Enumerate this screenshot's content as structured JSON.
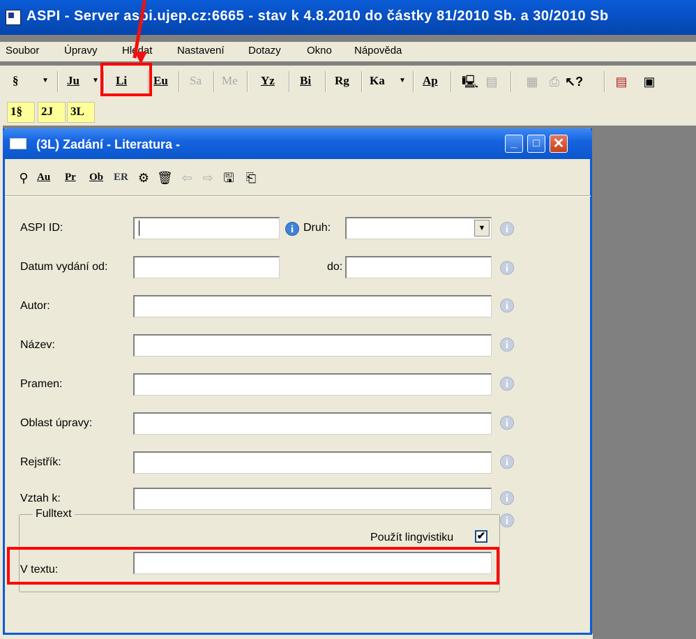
{
  "app": {
    "title": "ASPI - Server aspi.ujep.cz:6665 - stav k 4.8.2010 do částky 81/2010 Sb. a 30/2010 Sb"
  },
  "menu": [
    "Soubor",
    "Úpravy",
    "Hledat",
    "Nastavení",
    "Dotazy",
    "Okno",
    "Nápověda"
  ],
  "toolbar": {
    "buttons": [
      "§",
      "Ju",
      "Li",
      "Eu",
      "Sa",
      "Me",
      "Yz",
      "Bi",
      "Rg",
      "Ka",
      "Ap"
    ]
  },
  "tabs": [
    "1§",
    "2J",
    "3L"
  ],
  "window": {
    "title": "(3L)  Zadání - Literatura -",
    "minimize": "_",
    "maximize": "□",
    "close": "✕"
  },
  "form_toolbar": [
    "Au",
    "Pr",
    "Ob",
    "ER"
  ],
  "form": {
    "aspi_id_label": "ASPI ID:",
    "aspi_id_value": "",
    "druh_label": "Druh:",
    "druh_value": "",
    "datum_od_label": "Datum vydání  od:",
    "datum_do_label": "do:",
    "autor_label": "Autor:",
    "nazev_label": "Název:",
    "pramen_label": "Pramen:",
    "oblast_label": "Oblast úpravy:",
    "rejstrik_label": "Rejstřík:",
    "vztah_label": "Vztah k:",
    "fulltext_legend": "Fulltext",
    "lingvistika_label": "Použít lingvistiku",
    "lingvistika_checked": "✔",
    "v_textu_label": "V textu:",
    "info_glyph": "i"
  },
  "colors": {
    "highlight": "#ff0000",
    "titlebar": "#0850c4"
  }
}
